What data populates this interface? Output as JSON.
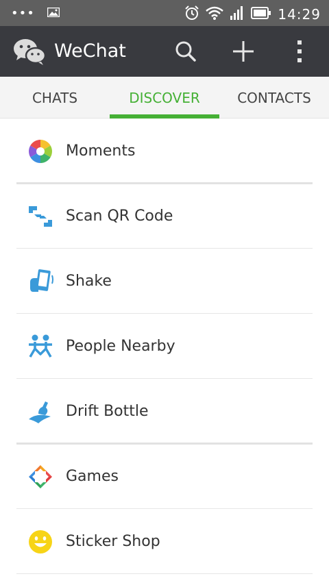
{
  "status_bar": {
    "dots": "•••",
    "time": "14:29",
    "icons": [
      "gallery-icon",
      "alarm-icon",
      "wifi-icon",
      "signal-icon",
      "battery-icon"
    ]
  },
  "app_bar": {
    "title": "WeChat",
    "background": "#393a3f",
    "actions": [
      "search-icon",
      "plus-icon",
      "more-vertical-icon"
    ]
  },
  "tabs": {
    "items": [
      {
        "label": "CHATS",
        "active": false
      },
      {
        "label": "DISCOVER",
        "active": true
      },
      {
        "label": "CONTACTS",
        "active": false
      }
    ],
    "accent": "#45b035"
  },
  "discover_items": [
    {
      "label": "Moments",
      "icon": "moments-icon"
    },
    {
      "label": "Scan QR Code",
      "icon": "scan-qr-icon"
    },
    {
      "label": "Shake",
      "icon": "shake-icon"
    },
    {
      "label": "People Nearby",
      "icon": "people-nearby-icon"
    },
    {
      "label": "Drift Bottle",
      "icon": "drift-bottle-icon"
    },
    {
      "label": "Games",
      "icon": "games-icon"
    },
    {
      "label": "Sticker Shop",
      "icon": "sticker-shop-icon"
    }
  ]
}
